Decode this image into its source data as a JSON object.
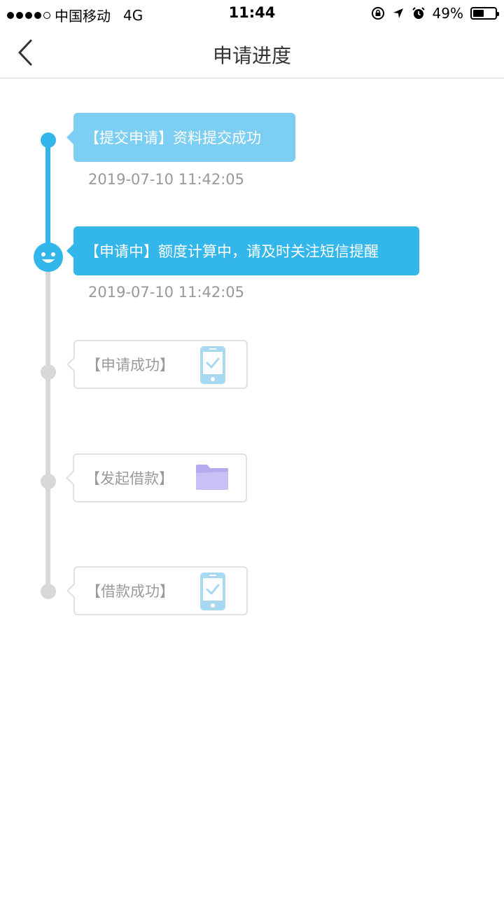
{
  "status_bar": {
    "carrier": "中国移动",
    "network": "4G",
    "time": "11:44",
    "battery": "49%",
    "battery_level": 0.49
  },
  "nav": {
    "title": "申请进度"
  },
  "timeline": {
    "active_color": "#33b6ea",
    "inactive_color": "#d8d8d8",
    "steps": [
      {
        "label": "【提交申请】资料提交成功",
        "time": "2019-07-10 11:42:05",
        "state": "done"
      },
      {
        "label": "【申请中】额度计算中，请及时关注短信提醒",
        "time": "2019-07-10 11:42:05",
        "state": "current"
      },
      {
        "label": "【申请成功】",
        "icon": "phone-check-icon",
        "state": "pending"
      },
      {
        "label": "【发起借款】",
        "icon": "folder-icon",
        "state": "pending"
      },
      {
        "label": "【借款成功】",
        "icon": "phone-check-icon",
        "state": "pending"
      }
    ]
  }
}
